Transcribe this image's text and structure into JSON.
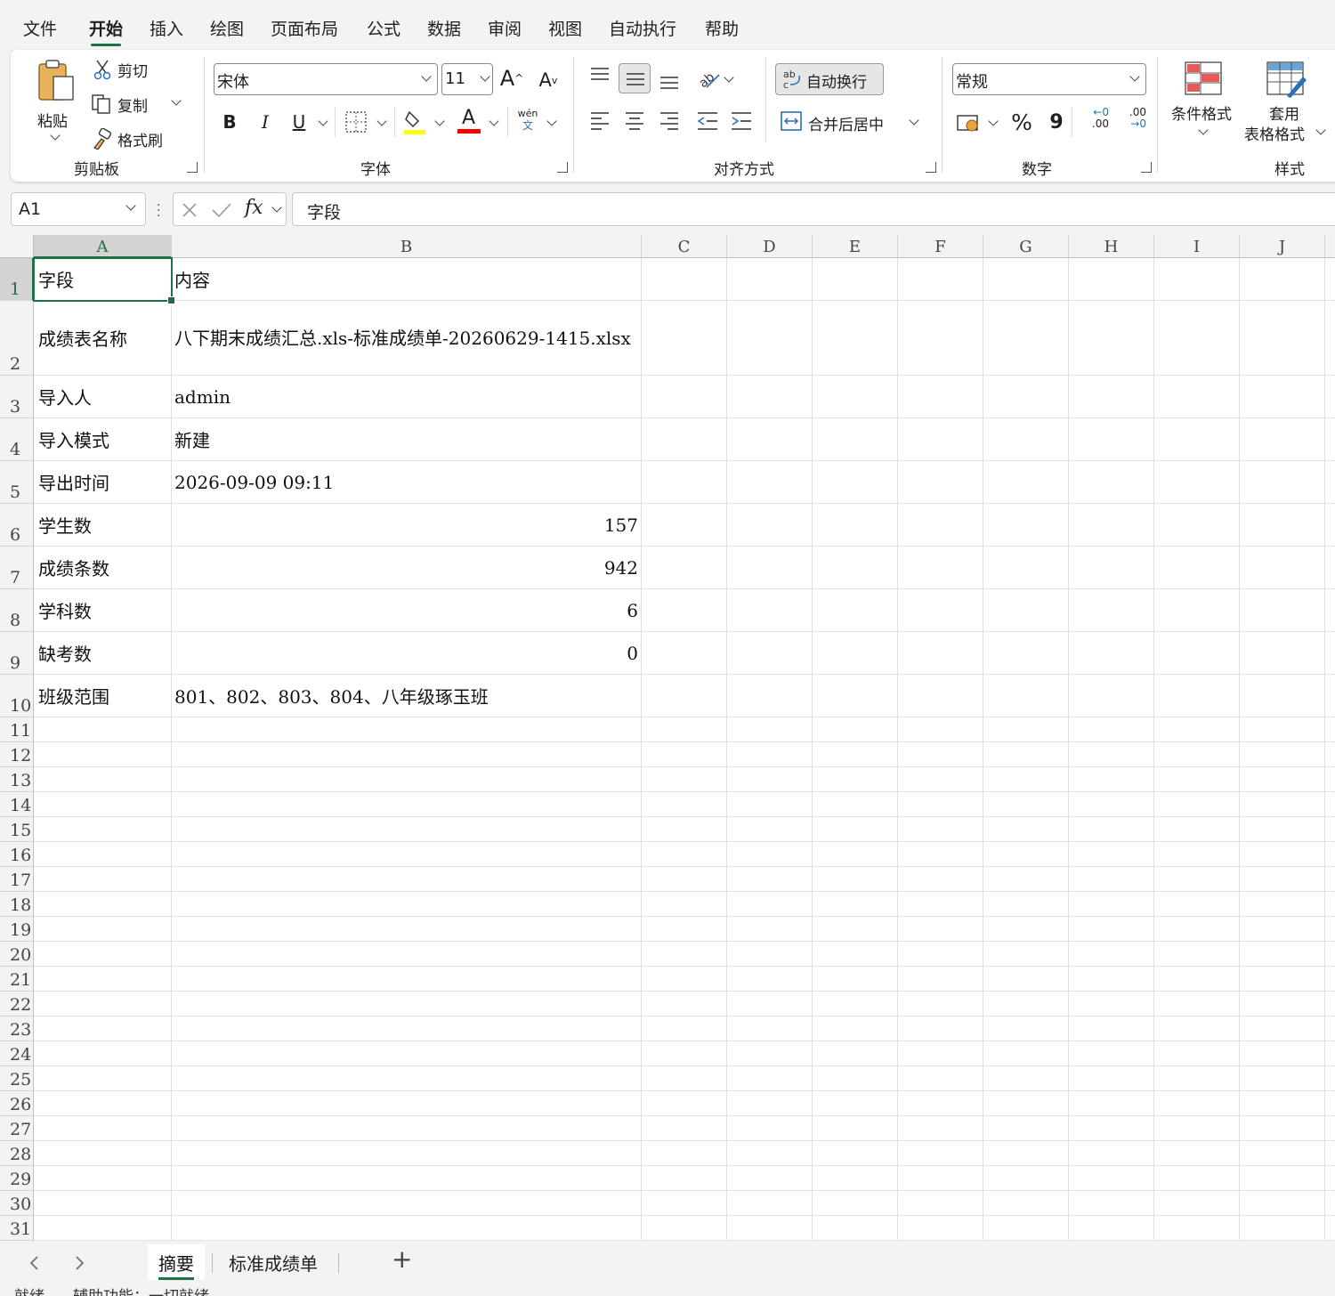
{
  "menu": {
    "tabs": [
      "文件",
      "开始",
      "插入",
      "绘图",
      "页面布局",
      "公式",
      "数据",
      "审阅",
      "视图",
      "自动执行",
      "帮助"
    ],
    "active_tab": "开始"
  },
  "ribbon": {
    "clipboard": {
      "group_label": "剪贴板",
      "paste": "粘贴",
      "cut": "剪切",
      "copy": "复制",
      "format_painter": "格式刷"
    },
    "font": {
      "group_label": "字体",
      "font_name": "宋体",
      "font_size": "11",
      "bold": "B",
      "italic": "I",
      "underline": "U",
      "phonetic_top": "wén",
      "phonetic_bottom": "文",
      "fill_color": "#ffff00",
      "font_color": "#ff0000"
    },
    "alignment": {
      "group_label": "对齐方式",
      "wrap_text": "自动换行",
      "merge_center": "合并后居中"
    },
    "number": {
      "group_label": "数字",
      "format": "常规",
      "percent": "%",
      "comma": "9",
      "inc_decimal_top": "0",
      "inc_decimal_bottom": ".00",
      "dec_decimal_top": ".00",
      "dec_decimal_bottom": "0"
    },
    "styles": {
      "group_label": "样式",
      "conditional_formatting": "条件格式",
      "format_as_table_line1": "套用",
      "format_as_table_line2": "表格格式"
    }
  },
  "formula_bar": {
    "name_box": "A1",
    "fx": "fx",
    "content": "字段"
  },
  "grid": {
    "columns": [
      "A",
      "B",
      "C",
      "D",
      "E",
      "F",
      "G",
      "H",
      "I",
      "J"
    ],
    "selected_column": "A",
    "selected_row": 1,
    "row_numbers": [
      "1",
      "2",
      "3",
      "4",
      "5",
      "6",
      "7",
      "8",
      "9",
      "10",
      "11",
      "12",
      "13",
      "14",
      "15",
      "16",
      "17",
      "18",
      "19",
      "20",
      "21",
      "22",
      "23",
      "24",
      "25",
      "26",
      "27",
      "28",
      "29",
      "30",
      "31"
    ],
    "rows": [
      {
        "a": "字段",
        "b": "内容",
        "num": false
      },
      {
        "a": "成绩表名称",
        "b": "八下期末成绩汇总.xls-标准成绩单-20260629-1415.xlsx",
        "num": false
      },
      {
        "a": "导入人",
        "b": "admin",
        "num": false
      },
      {
        "a": "导入模式",
        "b": "新建",
        "num": false
      },
      {
        "a": "导出时间",
        "b": "2026-09-09 09:11",
        "num": false
      },
      {
        "a": "学生数",
        "b": "157",
        "num": true
      },
      {
        "a": "成绩条数",
        "b": "942",
        "num": true
      },
      {
        "a": "学科数",
        "b": "6",
        "num": true
      },
      {
        "a": "缺考数",
        "b": "0",
        "num": true
      },
      {
        "a": "班级范围",
        "b": "801、802、803、804、八年级琢玉班",
        "num": false
      }
    ]
  },
  "sheets": {
    "tabs": [
      "摘要",
      "标准成绩单"
    ],
    "active": "摘要",
    "add": "+"
  },
  "status": {
    "ready": "就绪",
    "accessibility": "辅助功能：一切就绪"
  },
  "colors": {
    "accent": "#1e7145",
    "cell_border": "#e1e1e1",
    "header_bg": "#f3f3f3"
  }
}
